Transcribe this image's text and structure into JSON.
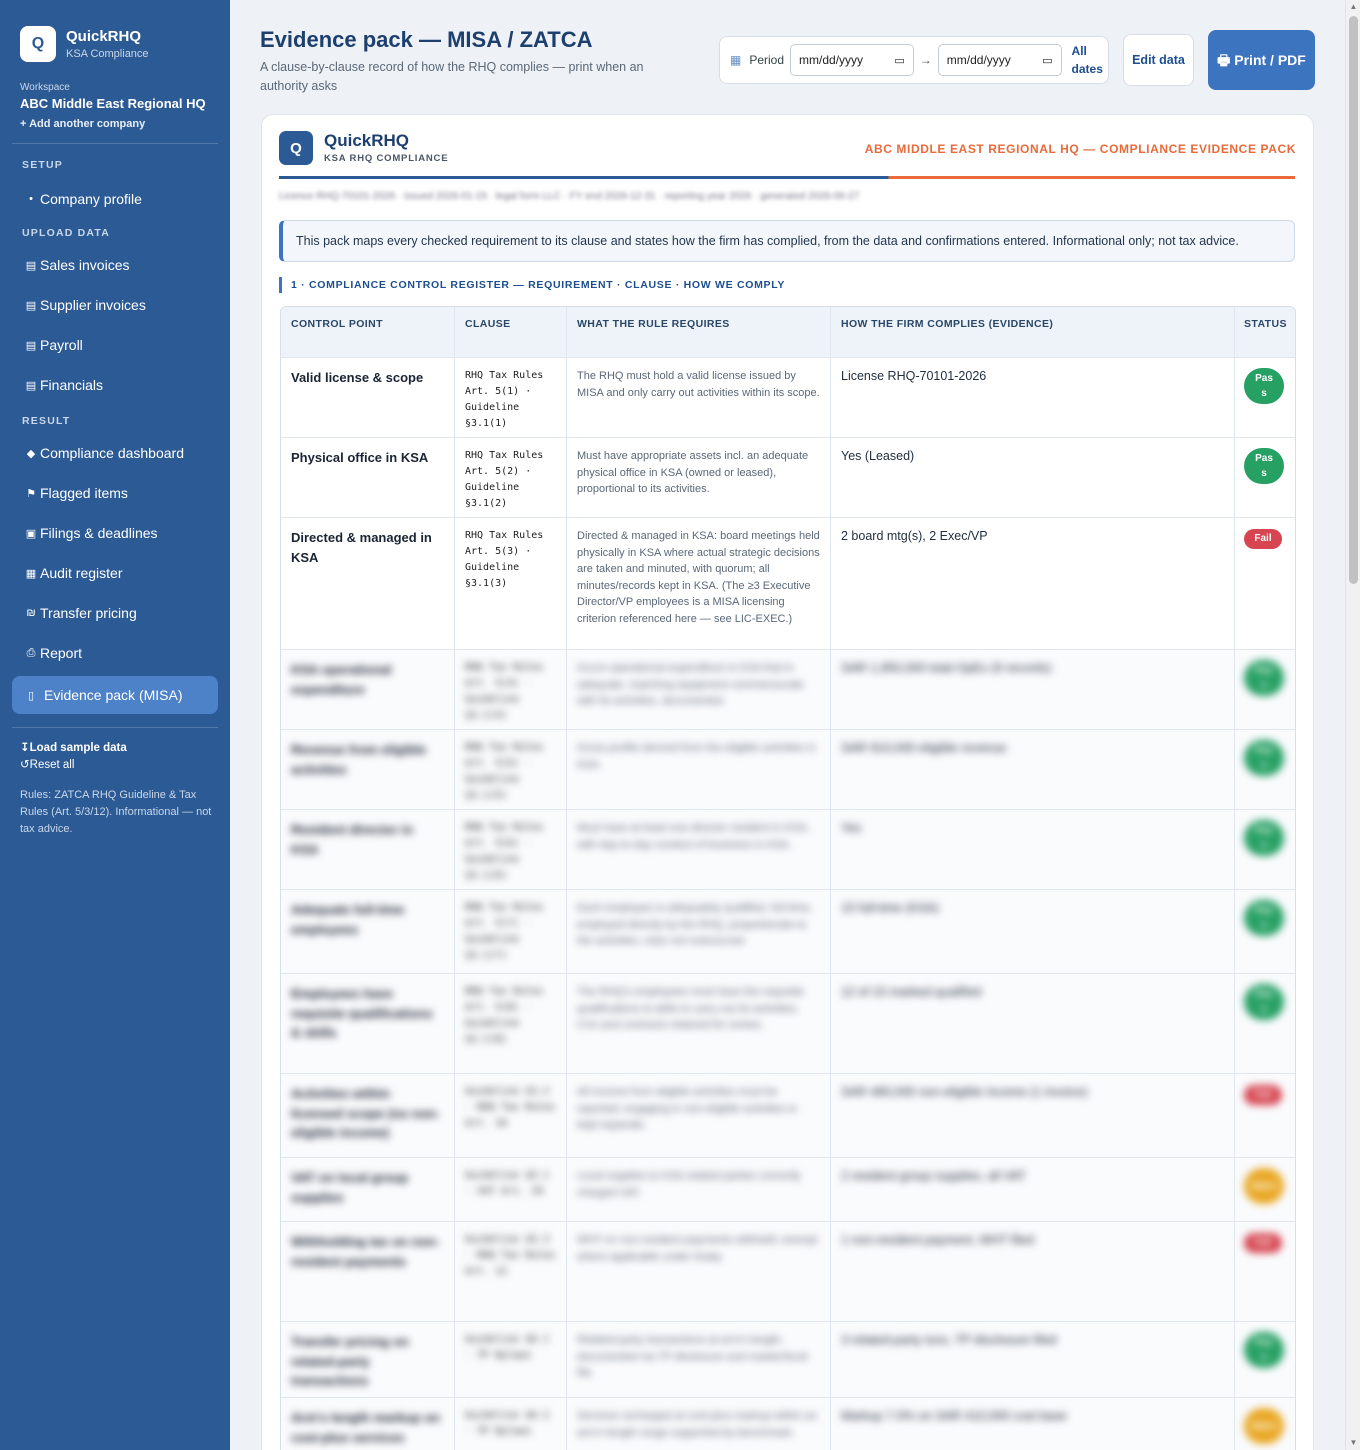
{
  "brand": {
    "logo_letter": "Q",
    "name": "QuickRHQ",
    "sub": "KSA Compliance"
  },
  "workspace": {
    "label": "Workspace",
    "name": "ABC Middle East Regional HQ",
    "add": "+ Add another company"
  },
  "nav": {
    "setup_label": "SETUP",
    "company_profile": {
      "icon": "•",
      "label": "Company profile"
    },
    "upload_label": "UPLOAD DATA",
    "sales": {
      "icon": "▤",
      "label": "Sales invoices"
    },
    "supplier": {
      "icon": "▤",
      "label": "Supplier invoices"
    },
    "payroll": {
      "icon": "▤",
      "label": "Payroll"
    },
    "financials": {
      "icon": "▤",
      "label": "Financials"
    },
    "result_label": "RESULT",
    "dashboard": {
      "icon": "◆",
      "label": "Compliance dashboard"
    },
    "flagged": {
      "icon": "⚑",
      "label": "Flagged items"
    },
    "filings": {
      "icon": "▣",
      "label": "Filings & deadlines"
    },
    "audit": {
      "icon": "▦",
      "label": "Audit register"
    },
    "transfer": {
      "icon": "₪",
      "label": "Transfer pricing"
    },
    "report": {
      "icon": "⎙",
      "label": "Report"
    },
    "evidence": {
      "icon": "▯",
      "label": "Evidence pack (MISA)"
    }
  },
  "sidebar_footer": {
    "load_sample": "↧Load sample data",
    "reset": "↺Reset all",
    "note": "Rules: ZATCA RHQ Guideline & Tax Rules (Art. 5/3/12). Informational — not tax advice."
  },
  "header": {
    "title": "Evidence pack — MISA / ZATCA",
    "subtitle": "A clause-by-clause record of how the RHQ complies — print when an authority asks",
    "period_label": "Period",
    "date_from_placeholder": "mm/dd/yyyy",
    "date_to_placeholder": "mm/dd/yyyy",
    "arrow": "→",
    "all_dates": "All dates",
    "edit_data": "Edit data",
    "print": "🖶 Print / PDF"
  },
  "card": {
    "logo_letter": "Q",
    "brand": "QuickRHQ",
    "brand_sub": "KSA RHQ COMPLIANCE",
    "title_right": "ABC MIDDLE EAST REGIONAL HQ — COMPLIANCE EVIDENCE PACK",
    "meta": "Licence RHQ-70101-2026 · issued 2026-01-15 · legal form LLC · FY end 2026-12-31 · reporting year 2026 · generated 2026-06-27",
    "notice": "This pack maps every checked requirement to its clause and states how the firm has complied, from the data and confirmations entered. Informational only; not tax advice.",
    "section_title": "1 · COMPLIANCE CONTROL REGISTER — REQUIREMENT · CLAUSE · HOW WE COMPLY"
  },
  "table": {
    "headers": [
      "CONTROL POINT",
      "CLAUSE",
      "WHAT THE RULE REQUIRES",
      "HOW THE FIRM COMPLIES (EVIDENCE)",
      "STATUS"
    ],
    "rows": [
      {
        "control": "Valid license & scope",
        "clause": "RHQ Tax Rules Art. 5(1) · Guideline §3.1(1)",
        "requires": "The RHQ must hold a valid license issued by MISA and only carry out activities within its scope.",
        "evidence": "License RHQ-70101-2026",
        "status": "Pass"
      },
      {
        "control": "Physical office in KSA",
        "clause": "RHQ Tax Rules Art. 5(2) · Guideline §3.1(2)",
        "requires": "Must have appropriate assets incl. an adequate physical office in KSA (owned or leased), proportional to its activities.",
        "evidence": "Yes (Leased)",
        "status": "Pass"
      },
      {
        "control": "Directed & managed in KSA",
        "clause": "RHQ Tax Rules Art. 5(3) · Guideline §3.1(3)",
        "requires": "Directed & managed in KSA: board meetings held physically in KSA where actual strategic decisions are taken and minuted, with quorum; all minutes/records kept in KSA. (The ≥3 Executive Director/VP employees is a MISA licensing criterion referenced here — see LIC-EXEC.)",
        "evidence": "2 board mtg(s), 2 Exec/VP",
        "status": "Fail"
      },
      {
        "control": "KSA operational expenditure",
        "clause": "RHQ Tax Rules Art. 5(4) · Guideline §3.1(4)",
        "requires": "Incurs operational expenditure in KSA that is adequate, matching equipment commensurate with its activities, documented.",
        "evidence": "SAR 1,950,000 total OpEx (9 records)",
        "status": "Pass"
      },
      {
        "control": "Revenue from eligible activities",
        "clause": "RHQ Tax Rules Art. 5(5) · Guideline §3.1(5)",
        "requires": "Gross profits derived from the eligible activities in KSA.",
        "evidence": "SAR 910,000 eligible revenue",
        "status": "Pass"
      },
      {
        "control": "Resident director in KSA",
        "clause": "RHQ Tax Rules Art. 5(6) · Guideline §3.1(6)",
        "requires": "Must have at least one director resident in KSA, with day-to-day conduct of business in KSA.",
        "evidence": "Yes",
        "status": "Pass"
      },
      {
        "control": "Adequate full-time employees",
        "clause": "RHQ Tax Rules Art. 5(7) · Guideline §3.1(7)",
        "requires": "Each employee is adequately qualified, full-time, employed directly by the RHQ, proportionate to the activities; roles not outsourced.",
        "evidence": "15 full-time (KSA)",
        "status": "Pass"
      },
      {
        "control": "Employees have requisite qualifications & skills",
        "clause": "RHQ Tax Rules Art. 5(8) · Guideline §3.1(8)",
        "requires": "The RHQ's employees must have the requisite qualifications & skills to carry out its activities; CVs and contracts retained for review.",
        "evidence": "12 of 15 marked qualified",
        "status": "Pass"
      },
      {
        "control": "Activities within licensed scope (no non-eligible income)",
        "clause": "Guideline §3.2 · RHQ Tax Rules Art. 10",
        "requires": "All income from eligible activities must be reported; engaging in non-eligible activities is kept separate.",
        "evidence": "SAR 480,000 non-eligible income (1 invoice)",
        "status": "Fail"
      },
      {
        "control": "VAT on local group supplies",
        "clause": "Guideline §5.1 · VAT Art. 29",
        "requires": "Local supplies to KSA related parties correctly charged VAT.",
        "evidence": "2 resident group supplies, all VAT",
        "status": "Warn"
      },
      {
        "control": "Withholding tax on non-resident payments",
        "clause": "Guideline §5.3 · RHQ Tax Rules Art. 12",
        "requires": "WHT on non-resident payments withheld; exempt where applicable under treaty.",
        "evidence": "1 non-resident payment, WHT filed",
        "status": "Fail"
      },
      {
        "control": "Transfer pricing on related-party transactions",
        "clause": "Guideline §6.1 · TP Bylaws",
        "requires": "Related-party transactions at arm's length, documented via TP disclosure and master/local file.",
        "evidence": "3 related-party txns, TP disclosure filed",
        "status": "Pass"
      },
      {
        "control": "Arm's length markup on cost-plus services",
        "clause": "Guideline §6.2 · TP Bylaws",
        "requires": "Services recharged at cost-plus markup within an arm's length range supported by benchmark.",
        "evidence": "Markup 7.0% on SAR 410,000 cost base",
        "status": "Warn"
      }
    ]
  }
}
